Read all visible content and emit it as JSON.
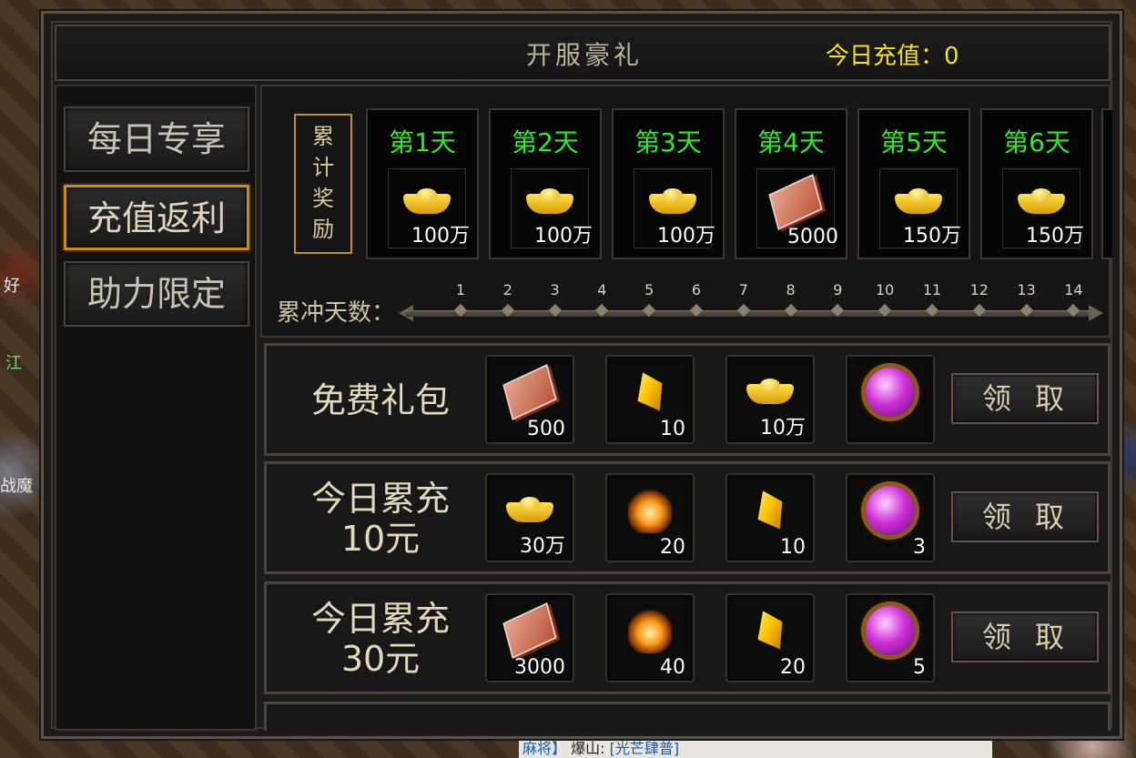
{
  "background": {
    "left_texts": [
      "好",
      "江",
      "战魔"
    ],
    "chat_left": "麻将】",
    "chat_mid": "爆山:",
    "chat_right": "[光芒肆普]"
  },
  "panel": {
    "title": "开服豪礼",
    "recharge_label": "今日充值：0"
  },
  "sidebar": {
    "tabs": [
      {
        "label": "每日专享",
        "active": false
      },
      {
        "label": "充值返利",
        "active": true
      },
      {
        "label": "助力限定",
        "active": false
      }
    ]
  },
  "cumulative": {
    "label": "累计奖励",
    "days": [
      {
        "label": "第1天",
        "icon": "gold-ingot-icon",
        "amount": "100万"
      },
      {
        "label": "第2天",
        "icon": "gold-ingot-icon",
        "amount": "100万"
      },
      {
        "label": "第3天",
        "icon": "gold-ingot-icon",
        "amount": "100万"
      },
      {
        "label": "第4天",
        "icon": "red-book-icon",
        "amount": "5000"
      },
      {
        "label": "第5天",
        "icon": "gold-ingot-icon",
        "amount": "150万"
      },
      {
        "label": "第6天",
        "icon": "gold-ingot-icon",
        "amount": "150万"
      }
    ],
    "rush_label": "累冲天数：",
    "rush_ticks": [
      "1",
      "2",
      "3",
      "4",
      "5",
      "6",
      "7",
      "8",
      "9",
      "10",
      "11",
      "12",
      "13",
      "14"
    ]
  },
  "rows": [
    {
      "title_line1": "免费礼包",
      "title_line2": "",
      "items": [
        {
          "icon": "red-book-icon",
          "count": "500"
        },
        {
          "icon": "yellow-crystal-icon",
          "count": "10"
        },
        {
          "icon": "gold-ingot-icon",
          "count": "10万"
        },
        {
          "icon": "purple-orb-icon",
          "count": ""
        }
      ],
      "button": "领取"
    },
    {
      "title_line1": "今日累充",
      "title_line2": "10元",
      "items": [
        {
          "icon": "gold-ingot-icon",
          "count": "30万"
        },
        {
          "icon": "fire-ore-icon",
          "count": "20"
        },
        {
          "icon": "yellow-crystal-icon",
          "count": "10"
        },
        {
          "icon": "purple-orb-icon",
          "count": "3"
        }
      ],
      "button": "领取"
    },
    {
      "title_line1": "今日累充",
      "title_line2": "30元",
      "items": [
        {
          "icon": "red-book-icon",
          "count": "3000"
        },
        {
          "icon": "fire-ore-icon",
          "count": "40"
        },
        {
          "icon": "yellow-crystal-icon",
          "count": "20"
        },
        {
          "icon": "purple-orb-icon",
          "count": "5"
        }
      ],
      "button": "领取"
    }
  ],
  "colors": {
    "accent_gold": "#c98a1e",
    "day_green": "#2ee82a",
    "recharge_yellow": "#f7e01a"
  }
}
